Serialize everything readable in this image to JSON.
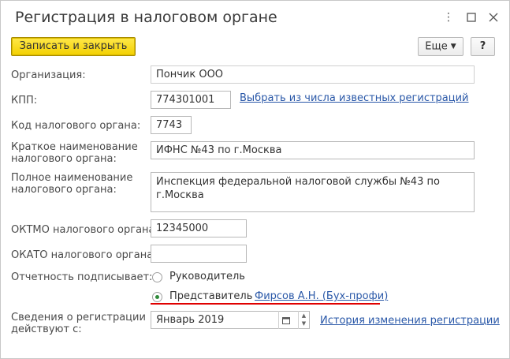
{
  "window": {
    "title": "Регистрация в налоговом органе",
    "more_icon": "more-vertical-icon",
    "maximize_icon": "maximize-icon",
    "close_icon": "close-icon"
  },
  "toolbar": {
    "save_close_label": "Записать и закрыть",
    "more_label": "Еще",
    "help_label": "?"
  },
  "form": {
    "organization": {
      "label": "Организация:",
      "value": "Пончик ООО"
    },
    "kpp": {
      "label": "КПП:",
      "value": "774301001",
      "link": "Выбрать из числа известных регистраций"
    },
    "tax_code": {
      "label": "Код налогового органа:",
      "value": "7743"
    },
    "short_name": {
      "label_line1": "Краткое наименование",
      "label_line2": "налогового органа:",
      "value": "ИФНС №43 по г.Москва"
    },
    "full_name": {
      "label_line1": "Полное наименование",
      "label_line2": "налогового органа:",
      "value": "Инспекция федеральной налоговой службы №43 по г.Москва"
    },
    "oktmo": {
      "label": "ОКТМО налогового органа:",
      "value": "12345000"
    },
    "okato": {
      "label": "ОКАТО налогового органа:",
      "value": ""
    },
    "signer": {
      "label": "Отчетность подписывает:",
      "option_head": "Руководитель",
      "option_rep": "Представитель",
      "selected": "Представитель",
      "rep_link": "Фирсов А.Н. (Бух-профи)"
    },
    "valid_from": {
      "label_line1": "Сведения о регистрации",
      "label_line2": "действуют с:",
      "value": "Январь 2019",
      "link": "История изменения регистрации"
    }
  },
  "colors": {
    "primary_button": "#f3d000",
    "link": "#2a58a8",
    "highlight_underline": "#e00000",
    "radio_selected": "#2f8a3a"
  }
}
